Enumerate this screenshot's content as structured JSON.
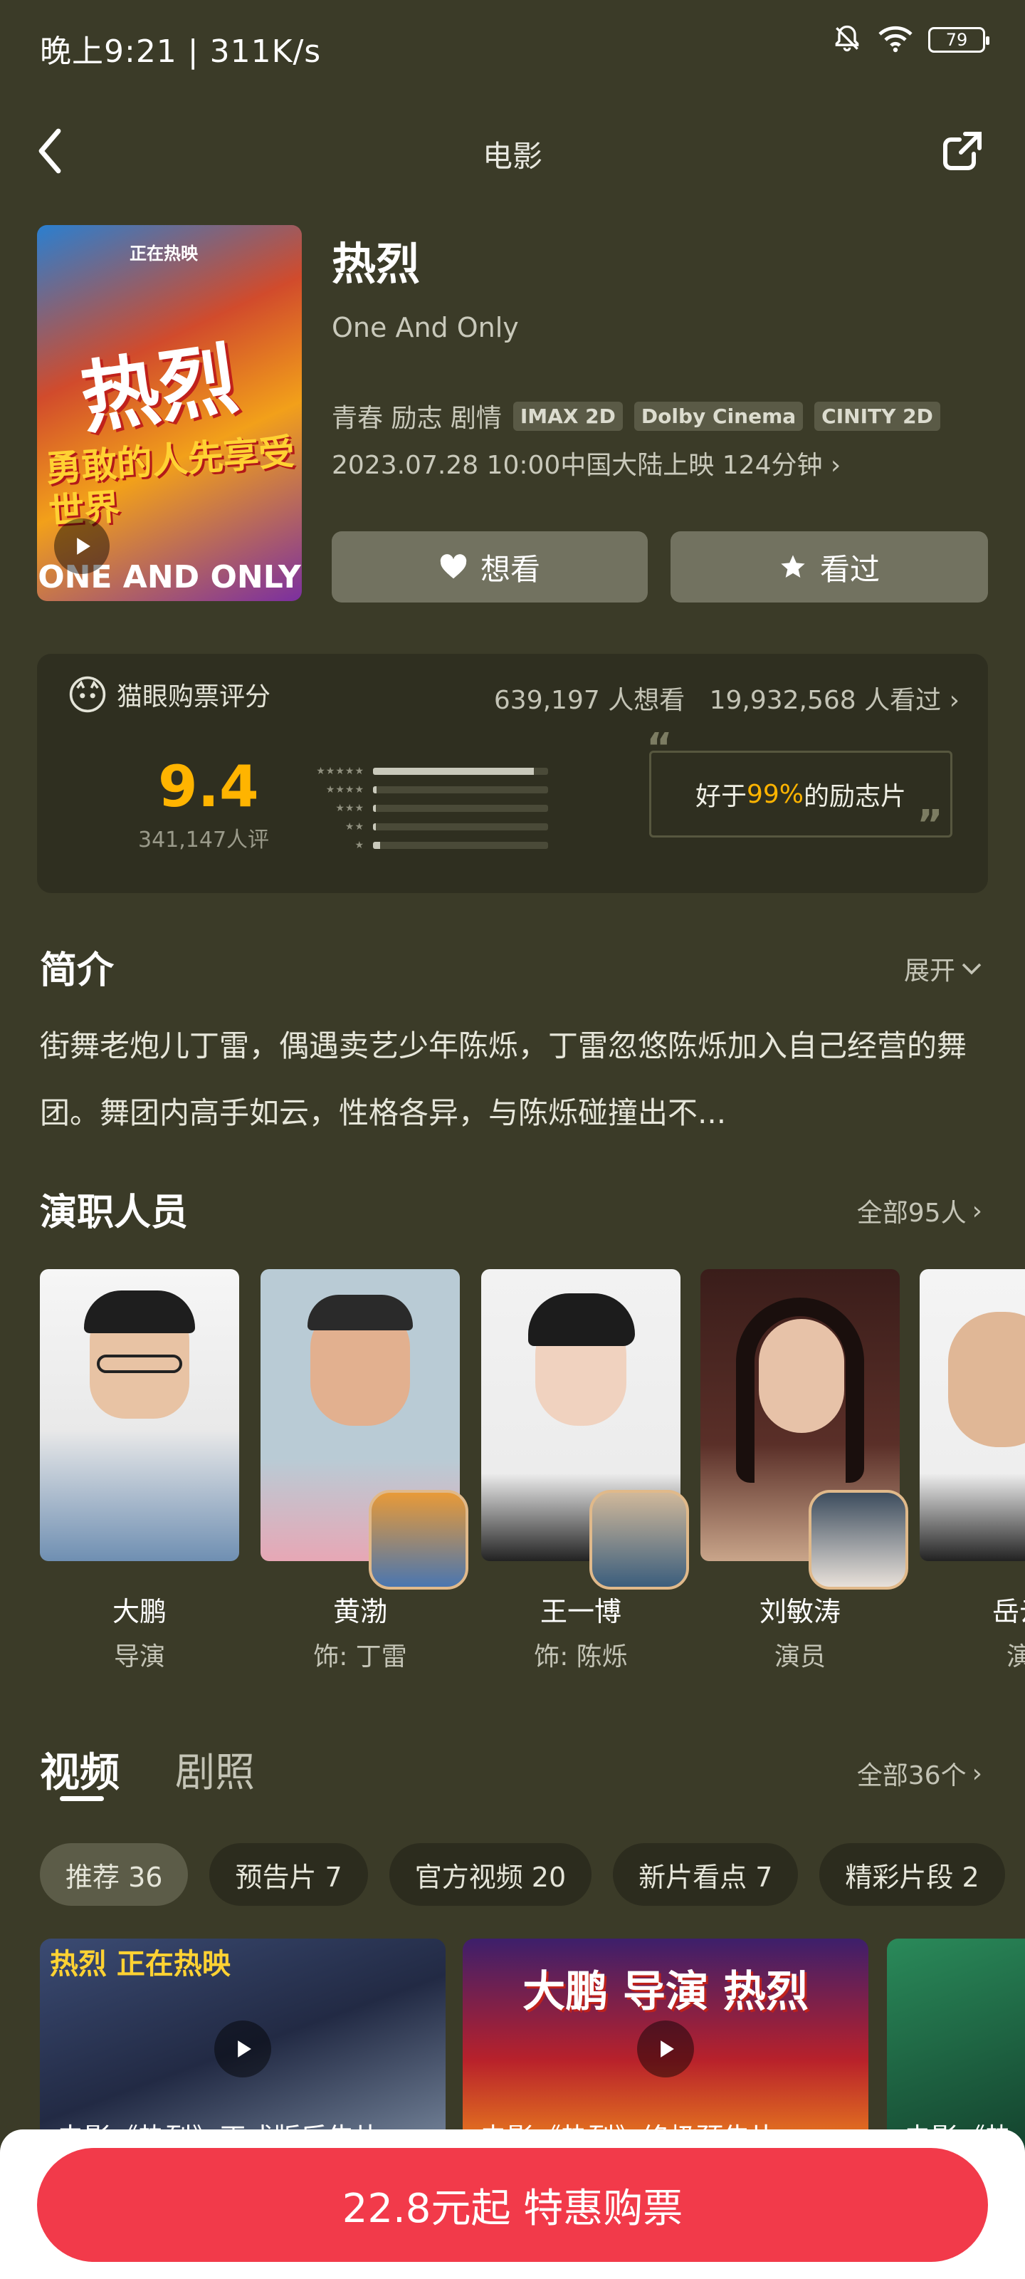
{
  "status_bar": {
    "time": "晚上9:21 | 311K/s",
    "battery": "79"
  },
  "nav": {
    "title": "电影"
  },
  "movie": {
    "poster": {
      "tag": "正在热映",
      "big_text": "热烈",
      "slogan": "勇敢的人先享受世界",
      "footer": "ONE AND ONLY"
    },
    "title": "热烈",
    "title_en": "One And Only",
    "genres": "青春 励志 剧情",
    "formats": [
      "IMAX 2D",
      "Dolby Cinema",
      "CINITY 2D"
    ],
    "release_info": "2023.07.28 10:00中国大陆上映 124分钟",
    "want_label": "想看",
    "seen_label": "看过"
  },
  "rating": {
    "title": "猫眼购票评分",
    "want_count": "639,197 人想看",
    "seen_count": "19,932,568 人看过",
    "score": "9.4",
    "rating_count": "341,147人评",
    "distribution": [
      0.92,
      0.02,
      0.01,
      0.01,
      0.04
    ],
    "quote_prefix": "好于",
    "quote_pct": "99%",
    "quote_suffix": "的励志片"
  },
  "intro": {
    "heading": "简介",
    "expand_label": "展开",
    "text": "街舞老炮儿丁雷，偶遇卖艺少年陈烁，丁雷忽悠陈烁加入自己经营的舞团。舞团内高手如云，性格各异，与陈烁碰撞出不..."
  },
  "cast": {
    "heading": "演职人员",
    "all_label": "全部95人",
    "members": [
      {
        "name": "大鹏",
        "role": "导演"
      },
      {
        "name": "黄渤",
        "role": "饰: 丁雷"
      },
      {
        "name": "王一博",
        "role": "饰: 陈烁"
      },
      {
        "name": "刘敏涛",
        "role": "演员"
      },
      {
        "name": "岳云",
        "role": "演"
      }
    ]
  },
  "media": {
    "tab_video": "视频",
    "tab_stills": "剧照",
    "all_label": "全部36个",
    "chips": [
      "推荐 36",
      "预告片 7",
      "官方视频 20",
      "新片看点 7",
      "精彩片段 2"
    ],
    "videos": [
      {
        "title": "电影《热烈》正式版后告片",
        "overlay": "热烈 正在热映"
      },
      {
        "title": "电影《热烈》终极预告片",
        "overlay": "大鹏 导演 热烈"
      },
      {
        "title": "电影《热",
        "overlay": ""
      }
    ]
  },
  "purchase": {
    "label": "22.8元起 特惠购票"
  },
  "colors": {
    "background": "#3b3b28",
    "accent": "#ffb400",
    "buy": "#f23a4a"
  }
}
